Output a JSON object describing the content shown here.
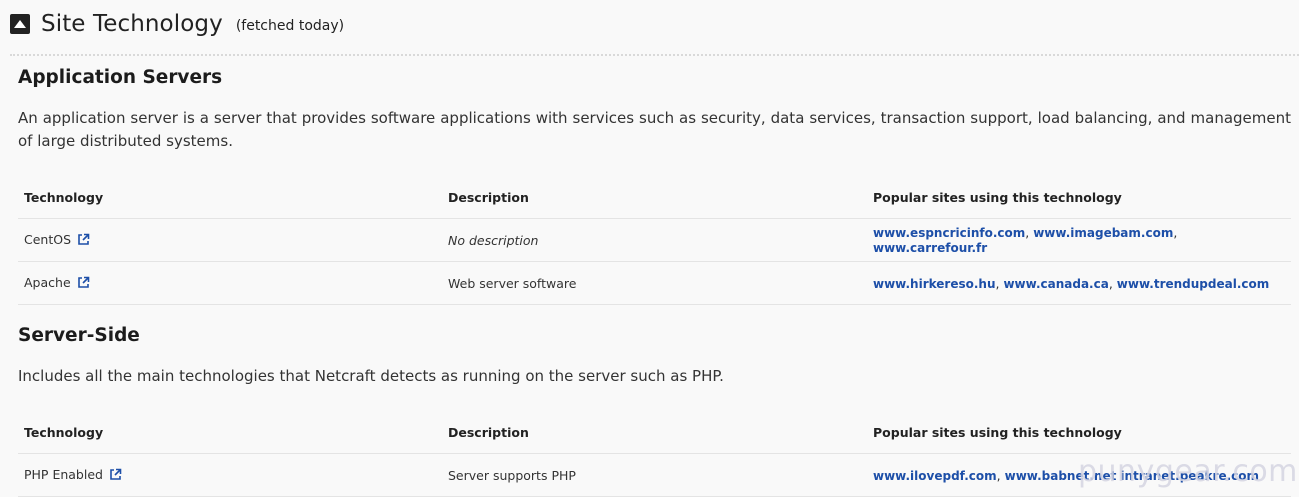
{
  "header": {
    "title": "Site Technology",
    "subtitle": "(fetched today)"
  },
  "sections": [
    {
      "title": "Application Servers",
      "description": "An application server is a server that provides software applications with services such as security, data services, transaction support, load balancing, and management of large distributed systems.",
      "columns": [
        "Technology",
        "Description",
        "Popular sites using this technology"
      ],
      "rows": [
        {
          "technology": "CentOS",
          "description": "No description",
          "sites": [
            "www.espncricinfo.com",
            "www.imagebam.com",
            "www.carrefour.fr"
          ]
        },
        {
          "technology": "Apache",
          "description": "Web server software",
          "sites": [
            "www.hirkereso.hu",
            "www.canada.ca",
            "www.trendupdeal.com"
          ]
        }
      ]
    },
    {
      "title": "Server-Side",
      "description": "Includes all the main technologies that Netcraft detects as running on the server such as PHP.",
      "columns": [
        "Technology",
        "Description",
        "Popular sites using this technology"
      ],
      "rows": [
        {
          "technology": "PHP Enabled",
          "description": "Server supports PHP",
          "sites": [
            "www.ilovepdf.com",
            "www.babnet.net",
            "intranet.peakre.com"
          ]
        }
      ]
    }
  ],
  "watermark": "punygear.com"
}
